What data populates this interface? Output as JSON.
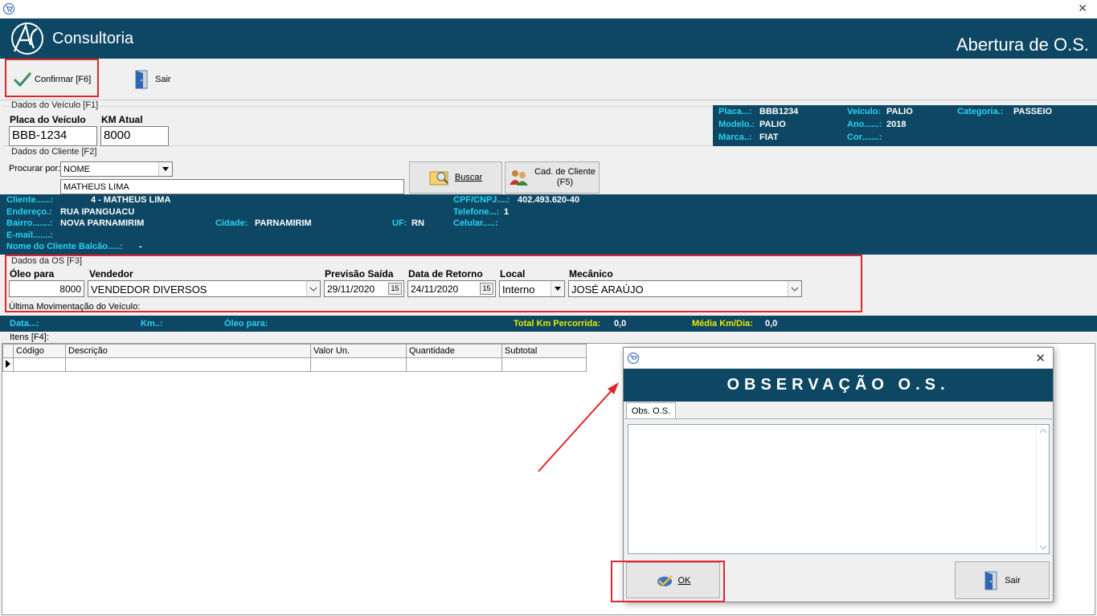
{
  "window": {
    "close_glyph": "✕"
  },
  "banner": {
    "brand": "Consultoria",
    "logo_text": "AC",
    "title": "Abertura de O.S."
  },
  "toolbar": {
    "confirm_label": "Confirmar [F6]",
    "exit_label": "Sair"
  },
  "vehicle": {
    "group_label": "Dados do Veículo [F1]",
    "plate_label": "Placa do Veículo",
    "plate_value": "BBB-1234",
    "km_label": "KM Atual",
    "km_value": "8000",
    "info": {
      "placa_label": "Placa...:",
      "placa_value": "BBB1234",
      "modelo_label": "Modelo.:",
      "modelo_value": "PALIO",
      "marca_label": "Marca..:",
      "marca_value": "FIAT",
      "veiculo_label": "Veículo:",
      "veiculo_value": "PALIO",
      "ano_label": "Ano......:",
      "ano_value": "2018",
      "cor_label": "Cor.......:",
      "cor_value": "",
      "categoria_label": "Categoria.:",
      "categoria_value": "PASSEIO"
    }
  },
  "client": {
    "group_label": "Dados do Cliente [F2]",
    "search_by_label": "Procurar por:",
    "search_by_value": "NOME",
    "search_text": "MATHEUS LIMA",
    "search_button": "Buscar",
    "register_button_line1": "Cad. de Cliente",
    "register_button_line2": "(F5)",
    "info": {
      "cliente_label": "Cliente......:",
      "cliente_value": "4  - MATHEUS LIMA",
      "endereco_label": "Endereço.:",
      "endereco_value": "RUA IPANGUACU",
      "bairro_label": "Bairro.......:",
      "bairro_value": "NOVA PARNAMIRIM",
      "email_label": "E-mail.......:",
      "balcao_label": "Nome do Cliente Balcão.....:",
      "balcao_value": "-",
      "cidade_label": "Cidade:",
      "cidade_value": "PARNAMIRIM",
      "uf_label": "UF:",
      "uf_value": "RN",
      "cpf_label": "CPF/CNPJ....:",
      "cpf_value": "402.493.620-40",
      "telefone_label": "Telefone...:",
      "telefone_value": "1",
      "celular_label": "Celular.....:"
    }
  },
  "os": {
    "group_label": "Dados da OS [F3]",
    "oleo_label": "Óleo para",
    "oleo_value": "8000",
    "vendedor_label": "Vendedor",
    "vendedor_value": "VENDEDOR DIVERSOS",
    "previsao_label": "Previsão Saída",
    "previsao_value": "29/11/2020",
    "retorno_label": "Data de Retorno",
    "retorno_value": "24/11/2020",
    "local_label": "Local",
    "local_value": "Interno",
    "mecanico_label": "Mecânico",
    "mecanico_value": "JOSÉ ARAÚJO",
    "calendar_glyph": "15"
  },
  "last_movement": {
    "label": "Última Movimentação do Veículo:",
    "data_label": "Data...:",
    "km_label": "Km..:",
    "oleo_label": "Óleo para:",
    "total_label": "Total Km Percorrida:",
    "total_value": "0,0",
    "media_label": "Média Km/Dia:",
    "media_value": "0,0"
  },
  "items": {
    "group_label": "Itens [F4]:",
    "columns": [
      "Código",
      "Descrição",
      "Valor Un.",
      "Quantidade",
      "Subtotal"
    ]
  },
  "dialog": {
    "title": "OBSERVAÇÃO O.S.",
    "tab": "Obs. O.S.",
    "ok_label": "OK",
    "exit_label": "Sair",
    "close_glyph": "✕"
  },
  "colors": {
    "panel": "#0d4763",
    "label_cyan": "#29d1f0",
    "highlight_yellow": "#e8e800",
    "annotation_red": "#e0262a"
  }
}
